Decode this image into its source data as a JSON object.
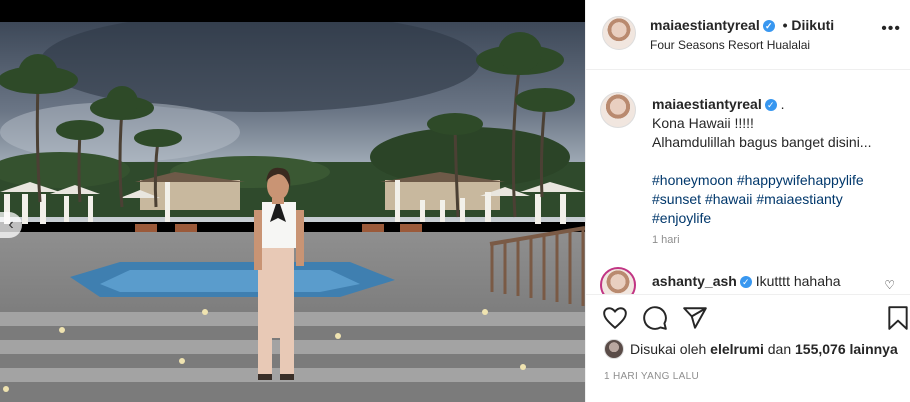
{
  "post": {
    "username": "maiaestiantyreal",
    "verified_mark": "✓",
    "separator": "•",
    "follow_status": "Diikuti",
    "location": "Four Seasons Resort Hualalai",
    "more_icon": "more-horizontal-icon"
  },
  "caption": {
    "username": "maiaestiantyreal",
    "trailing": ".",
    "line1": "Kona Hawaii !!!!!",
    "line2": "Alhamdulillah bagus banget disini...",
    "hashtags_line1": [
      "#honeymoon",
      "#happywifehappylife"
    ],
    "hashtags_line2": [
      "#sunset",
      "#hawaii",
      "#maiaestianty"
    ],
    "hashtags_line3": [
      "#enjoylife"
    ],
    "time": "1 hari"
  },
  "comment": {
    "username": "ashanty_ash",
    "text": "Ikutttt hahaha"
  },
  "likes": {
    "prefix": "Disukai oleh",
    "user": "elelrumi",
    "connector": "dan",
    "count": "155,076",
    "suffix": "lainnya"
  },
  "timestamp": "1 HARI YANG LALU",
  "colors": {
    "link": "#00376b",
    "verified": "#3897f0",
    "muted": "#8e8e8e"
  }
}
